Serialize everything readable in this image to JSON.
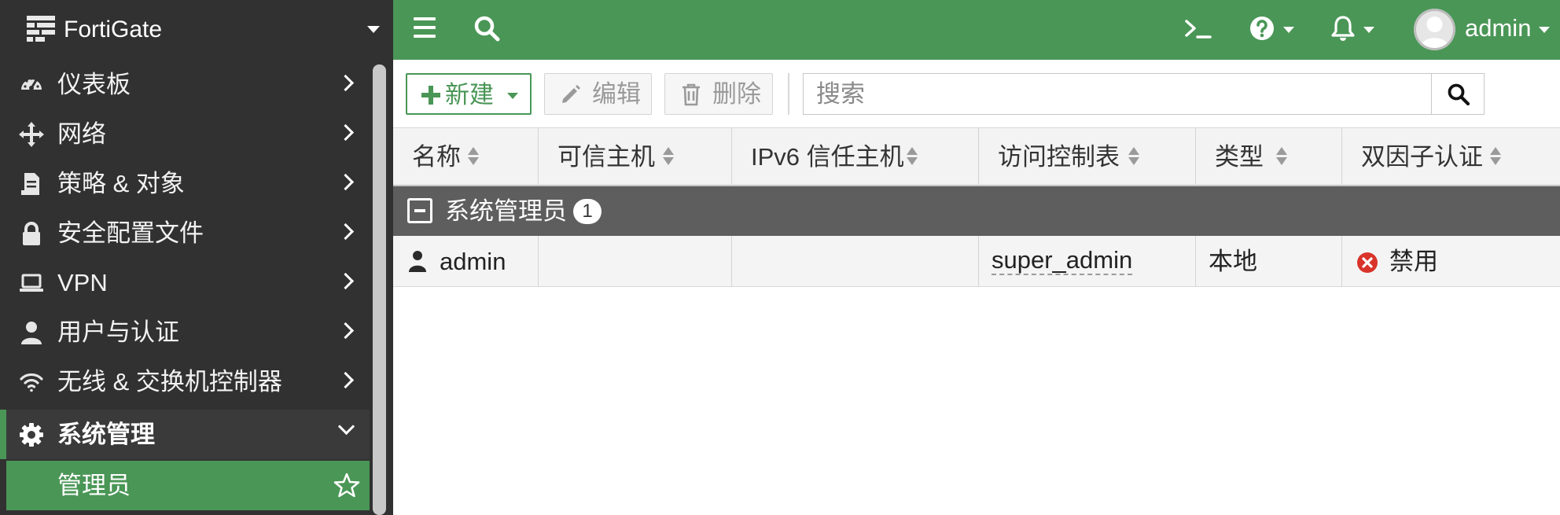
{
  "brand": {
    "name": "FortiGate"
  },
  "sidebar": {
    "items": [
      {
        "label": "仪表板",
        "icon": "dashboard-icon"
      },
      {
        "label": "网络",
        "icon": "network-move-icon"
      },
      {
        "label": "策略 & 对象",
        "icon": "policy-document-icon"
      },
      {
        "label": "安全配置文件",
        "icon": "lock-icon"
      },
      {
        "label": "VPN",
        "icon": "laptop-icon"
      },
      {
        "label": "用户与认证",
        "icon": "user-icon"
      },
      {
        "label": "无线 & 交换机控制器",
        "icon": "wifi-icon"
      },
      {
        "label": "系统管理",
        "icon": "gear-icon",
        "expanded": true
      }
    ],
    "active_subitem": {
      "label": "管理员",
      "icon": "star-icon"
    }
  },
  "topbar": {
    "icons": [
      "menu-icon",
      "search-icon",
      "cli-console-icon",
      "help-icon",
      "bell-icon"
    ],
    "user": "admin"
  },
  "toolbar": {
    "new_label": "新建",
    "edit_label": "编辑",
    "delete_label": "删除",
    "search_placeholder": "搜索"
  },
  "table": {
    "columns": [
      "名称",
      "可信主机",
      "IPv6 信任主机",
      "访问控制表",
      "类型",
      "双因子认证"
    ],
    "group": {
      "label": "系统管理员",
      "count": "1"
    },
    "rows": [
      {
        "name": "admin",
        "trusted_hosts": "",
        "ipv6_trusted_hosts": "",
        "profile": "super_admin",
        "type": "本地",
        "two_factor": "禁用"
      }
    ]
  },
  "colors": {
    "brand_green": "#4a9656",
    "sidebar_bg": "#313131",
    "group_row_bg": "#5e5e5e",
    "disabled_red": "#d9342b"
  }
}
